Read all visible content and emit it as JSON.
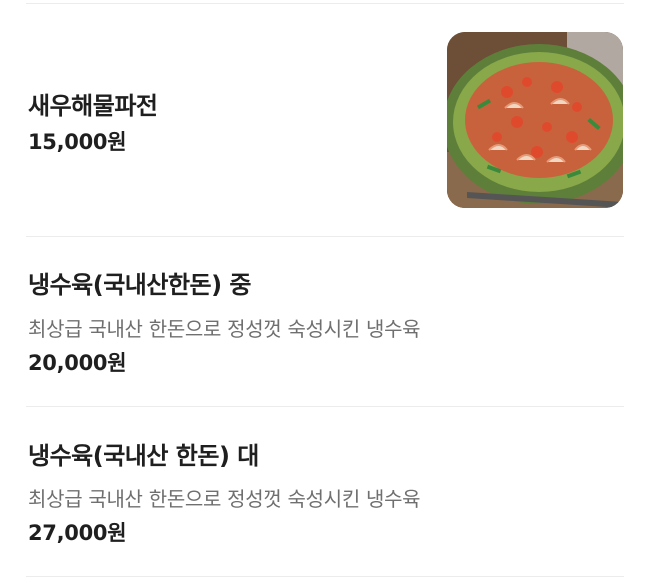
{
  "menu": {
    "items": [
      {
        "name": "새우해물파전",
        "description": "",
        "price": "15,000원",
        "image": "seafood-pancake-photo"
      },
      {
        "name": "냉수육(국내산한돈) 중",
        "description": "최상급 국내산 한돈으로 정성껏 숙성시킨 냉수육",
        "price": "20,000원"
      },
      {
        "name": "냉수육(국내산 한돈) 대",
        "description": "최상급 국내산 한돈으로 정성껏 숙성시킨 냉수육",
        "price": "27,000원"
      }
    ]
  }
}
